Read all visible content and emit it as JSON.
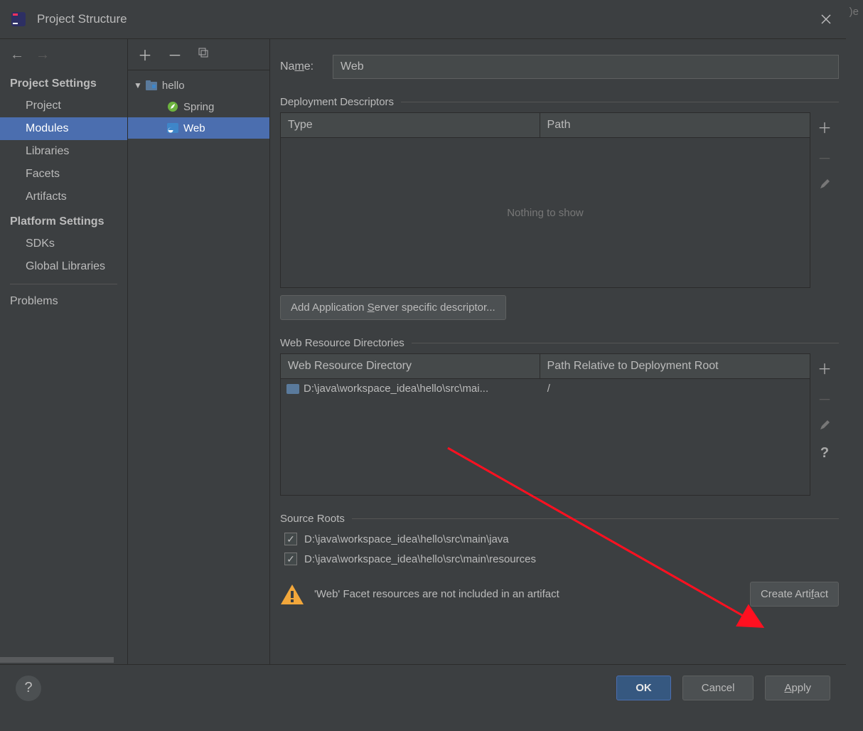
{
  "window": {
    "title": "Project Structure"
  },
  "sidebar": {
    "sections": [
      {
        "header": "Project Settings",
        "items": [
          "Project",
          "Modules",
          "Libraries",
          "Facets",
          "Artifacts"
        ],
        "selected": 1
      },
      {
        "header": "Platform Settings",
        "items": [
          "SDKs",
          "Global Libraries"
        ]
      }
    ],
    "problems": "Problems"
  },
  "tree": {
    "root": "hello",
    "children": [
      {
        "label": "Spring",
        "icon": "spring"
      },
      {
        "label": "Web",
        "icon": "web",
        "selected": true
      }
    ]
  },
  "main": {
    "name_label_pre": "Na",
    "name_label_u": "m",
    "name_label_post": "e:",
    "name_value": "Web",
    "dd_title": "Deployment Descriptors",
    "dd_headers": [
      "Type",
      "Path"
    ],
    "dd_empty": "Nothing to show",
    "dd_button_pre": "Add Application ",
    "dd_button_u": "S",
    "dd_button_post": "erver specific descriptor...",
    "wrd_title": "Web Resource Directories",
    "wrd_headers": [
      "Web Resource Directory",
      "Path Relative to Deployment Root"
    ],
    "wrd_row": {
      "dir": "D:\\java\\workspace_idea\\hello\\src\\mai...",
      "path": "/"
    },
    "sr_title": "Source Roots",
    "sr_items": [
      "D:\\java\\workspace_idea\\hello\\src\\main\\java",
      "D:\\java\\workspace_idea\\hello\\src\\main\\resources"
    ],
    "warning": "'Web' Facet resources are not included in an artifact",
    "create_artifact_pre": "Create Arti",
    "create_artifact_u": "f",
    "create_artifact_post": "act"
  },
  "footer": {
    "ok": "OK",
    "cancel": "Cancel",
    "apply_u": "A",
    "apply_post": "pply"
  },
  "edge": ")e"
}
